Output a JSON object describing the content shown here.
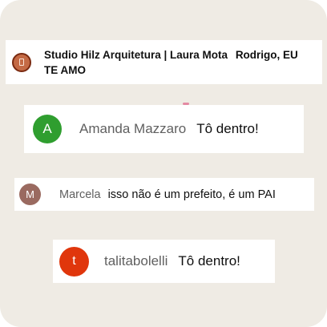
{
  "comments": [
    {
      "author": "Studio Hilz Arquitetura | Laura Mota",
      "message": "Rodrigo, EU TE AMO",
      "avatar_icon": "door-icon",
      "avatar_color": "#c46a45"
    },
    {
      "author": "Amanda Mazzaro",
      "message": "Tô dentro!",
      "avatar_letter": "A",
      "avatar_color": "#2f9e2f"
    },
    {
      "author": "Marcela",
      "message": "isso não é um prefeito, é um PAI",
      "avatar_letter": "M",
      "avatar_color": "#9a6a60"
    },
    {
      "author": "talitabolelli",
      "message": "Tô dentro!",
      "avatar_letter": "t",
      "avatar_color": "#e0360c"
    }
  ]
}
